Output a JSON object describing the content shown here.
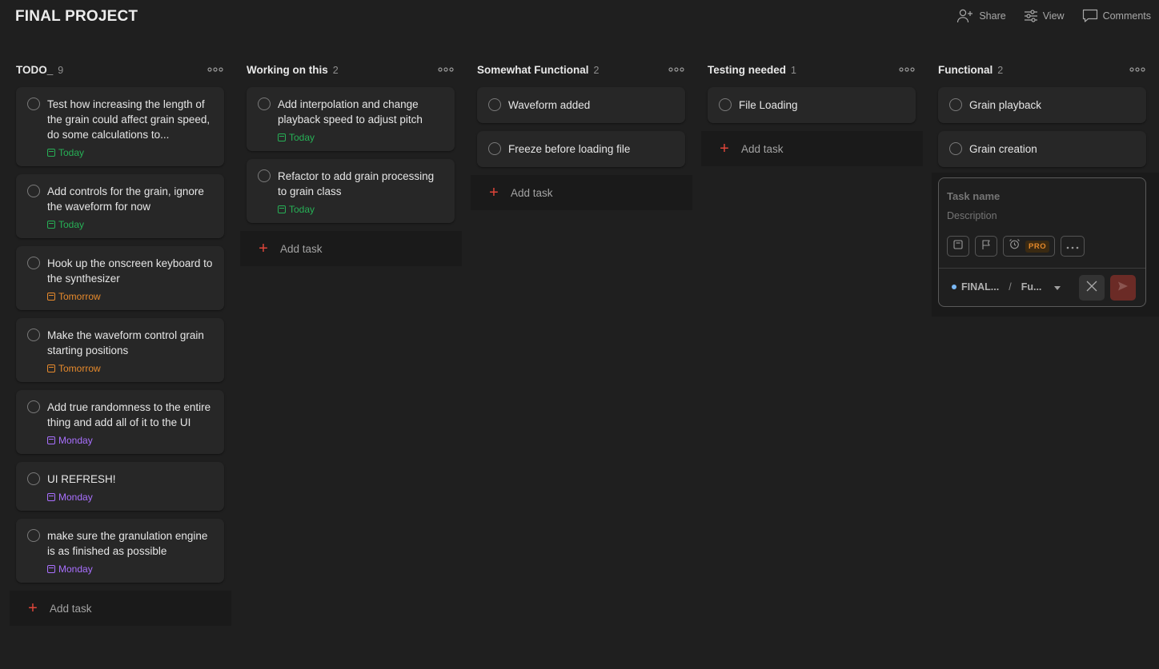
{
  "project": {
    "title": "FINAL PROJECT"
  },
  "topbar": {
    "share_label": "Share",
    "view_label": "View",
    "comments_label": "Comments"
  },
  "colors": {
    "today": "#27b056",
    "tomorrow": "#e78a2c",
    "monday": "#a970ff",
    "accent": "#e0453a"
  },
  "columns": [
    {
      "title": "TODO_",
      "count": "9",
      "add_label": "Add task",
      "tasks": [
        {
          "text": "Test how increasing the length of the grain could affect grain speed, do some calculations to...",
          "due": "Today",
          "due_type": "today"
        },
        {
          "text": "Add controls for the grain, ignore the waveform for now",
          "due": "Today",
          "due_type": "today"
        },
        {
          "text": "Hook up the onscreen keyboard to the synthesizer",
          "due": "Tomorrow",
          "due_type": "tomorrow"
        },
        {
          "text": "Make the waveform control grain starting positions",
          "due": "Tomorrow",
          "due_type": "tomorrow"
        },
        {
          "text": "Add true randomness to the entire thing and add all of it to the UI",
          "due": "Monday",
          "due_type": "monday"
        },
        {
          "text": "UI REFRESH!",
          "due": "Monday",
          "due_type": "monday"
        },
        {
          "text": "make sure the granulation engine is as finished as possible",
          "due": "Monday",
          "due_type": "monday"
        }
      ]
    },
    {
      "title": "Working on this",
      "count": "2",
      "add_label": "Add task",
      "tasks": [
        {
          "text": "Add interpolation and change playback speed to adjust pitch",
          "due": "Today",
          "due_type": "today"
        },
        {
          "text": "Refactor to add grain processing to grain class",
          "due": "Today",
          "due_type": "today"
        }
      ]
    },
    {
      "title": "Somewhat Functional",
      "count": "2",
      "add_label": "Add task",
      "tasks": [
        {
          "text": "Waveform added",
          "due": "",
          "due_type": ""
        },
        {
          "text": "Freeze before loading file",
          "due": "",
          "due_type": ""
        }
      ]
    },
    {
      "title": "Testing needed",
      "count": "1",
      "add_label": "Add task",
      "tasks": [
        {
          "text": "File Loading",
          "due": "",
          "due_type": ""
        }
      ]
    },
    {
      "title": "Functional",
      "count": "2",
      "add_label": "",
      "tasks": [
        {
          "text": "Grain playback",
          "due": "",
          "due_type": ""
        },
        {
          "text": "Grain creation",
          "due": "",
          "due_type": ""
        }
      ]
    }
  ],
  "editor": {
    "name_placeholder": "Task name",
    "description_placeholder": "Description",
    "pro_badge": "PRO",
    "project_short": "FINAL...",
    "section_short": "Fu..."
  }
}
